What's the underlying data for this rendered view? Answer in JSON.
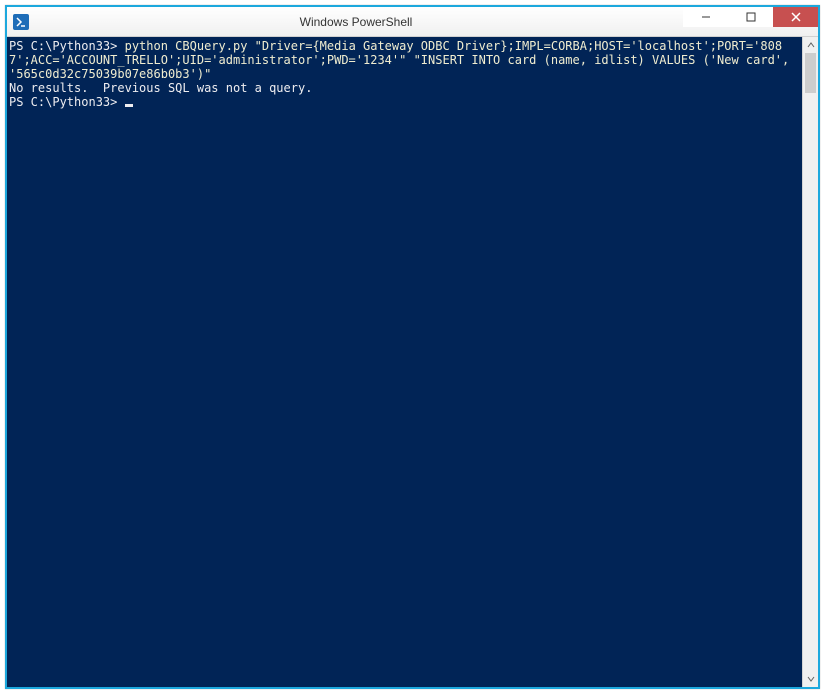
{
  "window": {
    "title": "Windows PowerShell"
  },
  "terminal": {
    "prompt1": "PS C:\\Python33>",
    "command1": " python CBQuery.py \"Driver={Media Gateway ODBC Driver};IMPL=CORBA;HOST='localhost';PORT='8087';ACC='ACCOUNT_TRELLO';UID='administrator';PWD='1234'\" \"INSERT INTO card (name, idlist) VALUES ('New card', '565c0d32c75039b07e86b0b3')\"",
    "output1": "No results.  Previous SQL was not a query.",
    "prompt2": "PS C:\\Python33>",
    "command2": " "
  }
}
